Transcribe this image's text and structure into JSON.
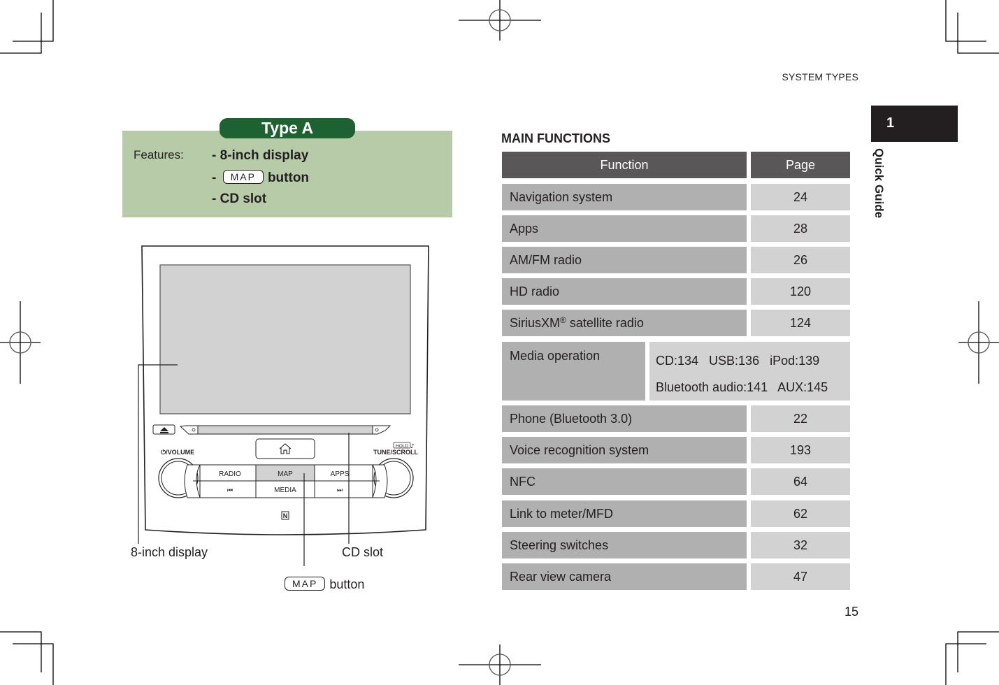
{
  "header": {
    "section_title": "SYSTEM TYPES"
  },
  "chapter_tab": {
    "number": "1",
    "label": "Quick Guide"
  },
  "type_box": {
    "badge": "Type A",
    "features_label": "Features:",
    "features": [
      {
        "prefix": "- ",
        "text": "8-inch display"
      },
      {
        "prefix": "- ",
        "key": "MAP",
        "text": "button"
      },
      {
        "prefix": "- ",
        "text": "CD slot"
      }
    ]
  },
  "head_unit": {
    "eject_icon": "eject-icon",
    "home_icon": "home-icon",
    "volume_label": "⏻/VOLUME",
    "tune_label": "TUNE/SCROLL",
    "hold_label": "HOLD",
    "music_note": "♪",
    "buttons_top": [
      "RADIO",
      "MAP",
      "APPS"
    ],
    "buttons_bottom": [
      "⏮",
      "MEDIA",
      "⏭"
    ],
    "nfc_mark": "N",
    "highlight_color": "#d2d2d2",
    "screen_color": "#d2d2d2"
  },
  "callouts": {
    "display": "8-inch display",
    "cd_slot": "CD slot",
    "map_key": "MAP",
    "map_button": "button"
  },
  "main_functions": {
    "title": "MAIN FUNCTIONS",
    "headers": {
      "function": "Function",
      "page": "Page"
    },
    "rows": [
      {
        "function": "Navigation system",
        "page": "24"
      },
      {
        "function": "Apps",
        "page": "28"
      },
      {
        "function": "AM/FM radio",
        "page": "26"
      },
      {
        "function": "HD radio",
        "page": "120"
      },
      {
        "function": "SiriusXM",
        "sup": "®",
        "function_suffix": " satellite radio",
        "page": "124"
      },
      {
        "function": "Media operation",
        "page_line1": "CD:134   USB:136   iPod:139",
        "page_line2": "Bluetooth audio:141   AUX:145"
      },
      {
        "function": "Phone (Bluetooth 3.0)",
        "page": "22"
      },
      {
        "function": "Voice recognition system",
        "page": "193"
      },
      {
        "function": "NFC",
        "page": "64"
      },
      {
        "function": "Link to meter/MFD",
        "page": "62"
      },
      {
        "function": "Steering switches",
        "page": "32"
      },
      {
        "function": "Rear view camera",
        "page": "47"
      }
    ],
    "colors": {
      "header": "#595758",
      "function_cell": "#b0b0b0",
      "page_cell": "#d2d2d2"
    }
  },
  "footer": {
    "page_number": "15"
  },
  "colors": {
    "type_badge": "#1e6132",
    "features_bg": "#b7cba9",
    "chapter_tab": "#231f20"
  }
}
